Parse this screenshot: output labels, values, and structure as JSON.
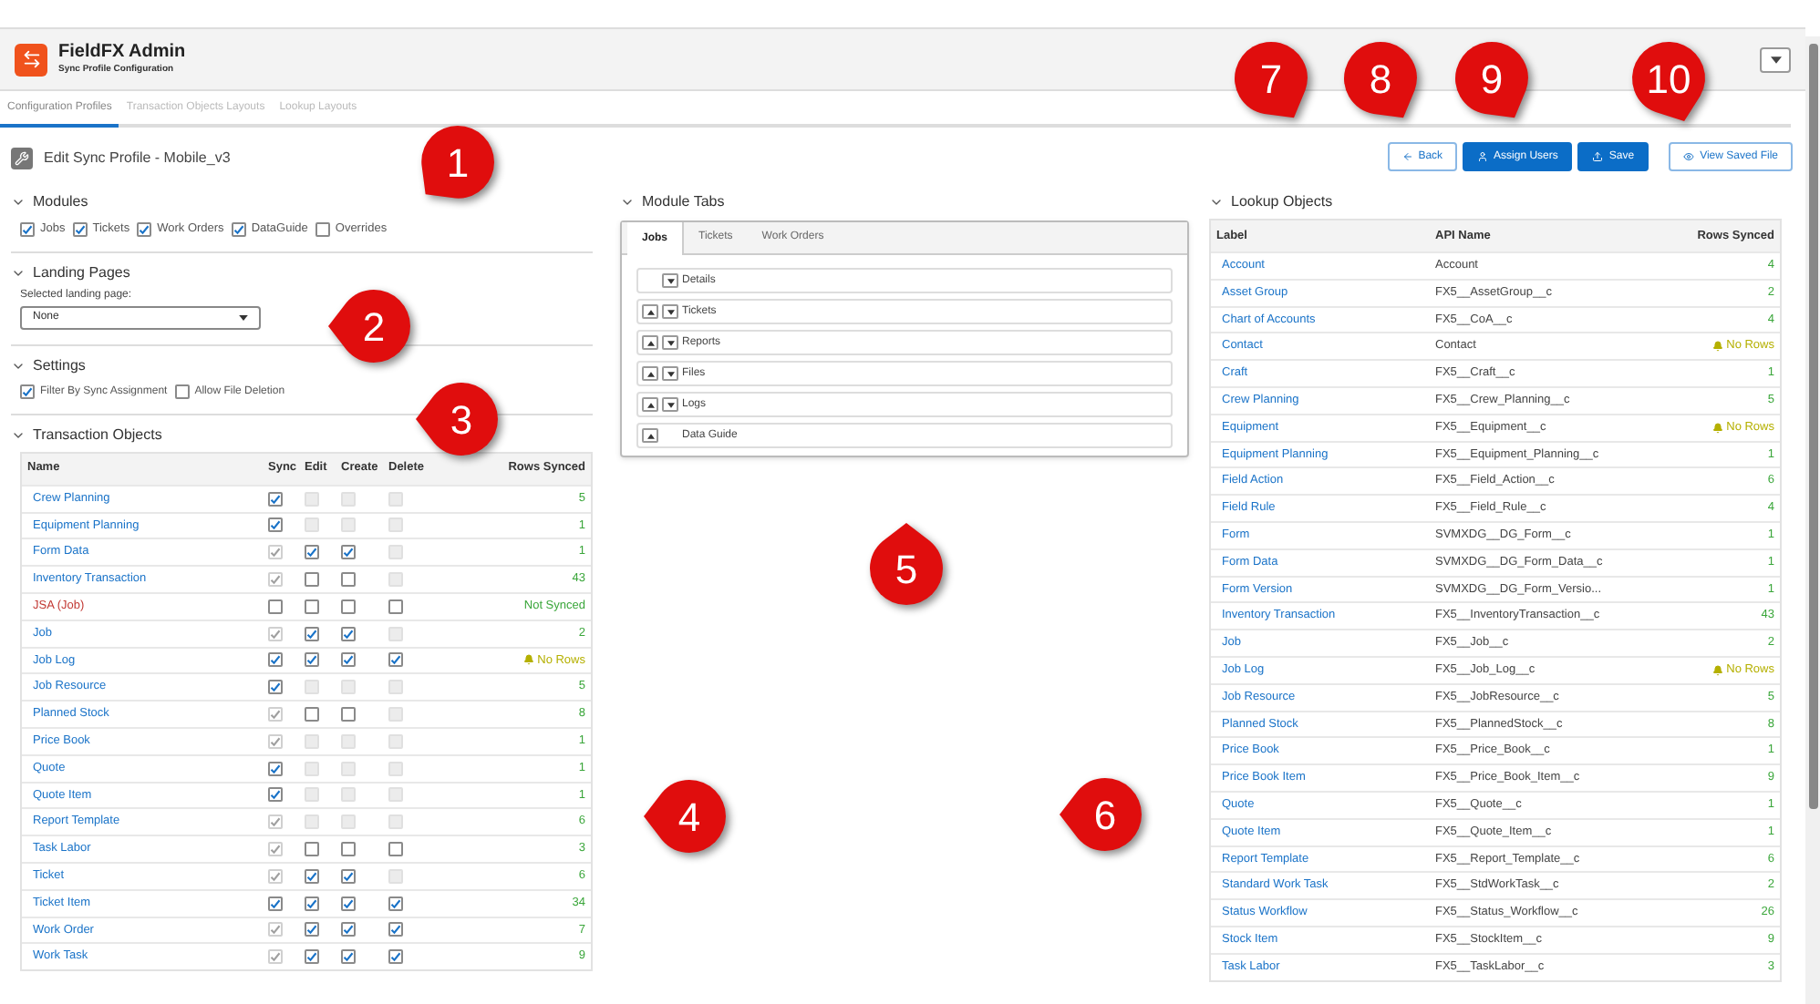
{
  "app": {
    "title": "FieldFX Admin",
    "subtitle": "Sync Profile Configuration"
  },
  "tabs": [
    {
      "label": "Configuration Profiles",
      "selected": true
    },
    {
      "label": "Transaction Objects Layouts",
      "selected": false
    },
    {
      "label": "Lookup Layouts",
      "selected": false
    }
  ],
  "page_title": "Edit Sync Profile - Mobile_v3",
  "actions": [
    {
      "label": "Back",
      "kind": "outline"
    },
    {
      "label": "Assign Users",
      "kind": "primary"
    },
    {
      "label": "Save",
      "kind": "primary"
    },
    {
      "label": "View Saved File",
      "kind": "outline"
    }
  ],
  "modules": {
    "title": "Modules",
    "expanded": true,
    "options": [
      {
        "label": "Jobs",
        "checked": true
      },
      {
        "label": "Tickets",
        "checked": true
      },
      {
        "label": "Work Orders",
        "checked": true
      },
      {
        "label": "DataGuide",
        "checked": true
      },
      {
        "label": "Overrides",
        "checked": false
      }
    ]
  },
  "landing_pages": {
    "title": "Landing Pages",
    "expanded": true,
    "label": "Selected landing page:",
    "value": "None"
  },
  "settings": {
    "title": "Settings",
    "expanded": true,
    "options": [
      {
        "label": "Filter By Sync Assignment",
        "checked": true
      },
      {
        "label": "Allow File Deletion",
        "checked": false
      }
    ]
  },
  "transaction_objects": {
    "title": "Transaction Objects",
    "expanded": true,
    "columns": [
      "Name",
      "Sync",
      "Edit",
      "Create",
      "Delete",
      "Rows Synced"
    ],
    "rows": [
      {
        "name": "Crew Planning",
        "kind": "count",
        "rows_synced": "5",
        "sync": {
          "checked": true,
          "disabled": false
        },
        "edit": {
          "checked": false,
          "disabled": true
        },
        "create": {
          "checked": false,
          "disabled": true
        },
        "delete": {
          "checked": false,
          "disabled": true
        }
      },
      {
        "name": "Equipment Planning",
        "kind": "count",
        "rows_synced": "1",
        "sync": {
          "checked": true,
          "disabled": false
        },
        "edit": {
          "checked": false,
          "disabled": true
        },
        "create": {
          "checked": false,
          "disabled": true
        },
        "delete": {
          "checked": false,
          "disabled": true
        }
      },
      {
        "name": "Form Data",
        "kind": "count",
        "rows_synced": "1",
        "sync": {
          "checked": true,
          "disabled": true
        },
        "edit": {
          "checked": true,
          "disabled": false
        },
        "create": {
          "checked": true,
          "disabled": false
        },
        "delete": {
          "checked": false,
          "disabled": true
        }
      },
      {
        "name": "Inventory Transaction",
        "kind": "count",
        "rows_synced": "43",
        "sync": {
          "checked": true,
          "disabled": true
        },
        "edit": {
          "checked": false,
          "disabled": false
        },
        "create": {
          "checked": false,
          "disabled": false
        },
        "delete": {
          "checked": false,
          "disabled": true
        }
      },
      {
        "name": "JSA (Job)",
        "kind": "not_synced",
        "rows_synced": "Not Synced",
        "sync": {
          "checked": false,
          "disabled": false
        },
        "edit": {
          "checked": false,
          "disabled": false
        },
        "create": {
          "checked": false,
          "disabled": false
        },
        "delete": {
          "checked": false,
          "disabled": false
        }
      },
      {
        "name": "Job",
        "kind": "count",
        "rows_synced": "2",
        "sync": {
          "checked": true,
          "disabled": true
        },
        "edit": {
          "checked": true,
          "disabled": false
        },
        "create": {
          "checked": true,
          "disabled": false
        },
        "delete": {
          "checked": false,
          "disabled": true
        }
      },
      {
        "name": "Job Log",
        "kind": "no_rows",
        "rows_synced": "No Rows",
        "sync": {
          "checked": true,
          "disabled": false
        },
        "edit": {
          "checked": true,
          "disabled": false
        },
        "create": {
          "checked": true,
          "disabled": false
        },
        "delete": {
          "checked": true,
          "disabled": false
        }
      },
      {
        "name": "Job Resource",
        "kind": "count",
        "rows_synced": "5",
        "sync": {
          "checked": true,
          "disabled": false
        },
        "edit": {
          "checked": false,
          "disabled": true
        },
        "create": {
          "checked": false,
          "disabled": true
        },
        "delete": {
          "checked": false,
          "disabled": true
        }
      },
      {
        "name": "Planned Stock",
        "kind": "count",
        "rows_synced": "8",
        "sync": {
          "checked": true,
          "disabled": true
        },
        "edit": {
          "checked": false,
          "disabled": false
        },
        "create": {
          "checked": false,
          "disabled": false
        },
        "delete": {
          "checked": false,
          "disabled": true
        }
      },
      {
        "name": "Price Book",
        "kind": "count",
        "rows_synced": "1",
        "sync": {
          "checked": true,
          "disabled": true
        },
        "edit": {
          "checked": false,
          "disabled": true
        },
        "create": {
          "checked": false,
          "disabled": true
        },
        "delete": {
          "checked": false,
          "disabled": true
        }
      },
      {
        "name": "Quote",
        "kind": "count",
        "rows_synced": "1",
        "sync": {
          "checked": true,
          "disabled": false
        },
        "edit": {
          "checked": false,
          "disabled": true
        },
        "create": {
          "checked": false,
          "disabled": true
        },
        "delete": {
          "checked": false,
          "disabled": true
        }
      },
      {
        "name": "Quote Item",
        "kind": "count",
        "rows_synced": "1",
        "sync": {
          "checked": true,
          "disabled": false
        },
        "edit": {
          "checked": false,
          "disabled": true
        },
        "create": {
          "checked": false,
          "disabled": true
        },
        "delete": {
          "checked": false,
          "disabled": true
        }
      },
      {
        "name": "Report Template",
        "kind": "count",
        "rows_synced": "6",
        "sync": {
          "checked": true,
          "disabled": true
        },
        "edit": {
          "checked": false,
          "disabled": true
        },
        "create": {
          "checked": false,
          "disabled": true
        },
        "delete": {
          "checked": false,
          "disabled": true
        }
      },
      {
        "name": "Task Labor",
        "kind": "count",
        "rows_synced": "3",
        "sync": {
          "checked": true,
          "disabled": true
        },
        "edit": {
          "checked": false,
          "disabled": false
        },
        "create": {
          "checked": false,
          "disabled": false
        },
        "delete": {
          "checked": false,
          "disabled": false
        }
      },
      {
        "name": "Ticket",
        "kind": "count",
        "rows_synced": "6",
        "sync": {
          "checked": true,
          "disabled": true
        },
        "edit": {
          "checked": true,
          "disabled": false
        },
        "create": {
          "checked": true,
          "disabled": false
        },
        "delete": {
          "checked": false,
          "disabled": true
        }
      },
      {
        "name": "Ticket Item",
        "kind": "count",
        "rows_synced": "34",
        "sync": {
          "checked": true,
          "disabled": false
        },
        "edit": {
          "checked": true,
          "disabled": false
        },
        "create": {
          "checked": true,
          "disabled": false
        },
        "delete": {
          "checked": true,
          "disabled": false
        }
      },
      {
        "name": "Work Order",
        "kind": "count",
        "rows_synced": "7",
        "sync": {
          "checked": true,
          "disabled": true
        },
        "edit": {
          "checked": true,
          "disabled": false
        },
        "create": {
          "checked": true,
          "disabled": false
        },
        "delete": {
          "checked": true,
          "disabled": false
        }
      },
      {
        "name": "Work Task",
        "kind": "count",
        "rows_synced": "9",
        "sync": {
          "checked": true,
          "disabled": true
        },
        "edit": {
          "checked": true,
          "disabled": false
        },
        "create": {
          "checked": true,
          "disabled": false
        },
        "delete": {
          "checked": true,
          "disabled": false
        }
      }
    ]
  },
  "module_tabs": {
    "title": "Module Tabs",
    "expanded": true,
    "tabs": [
      {
        "label": "Jobs",
        "selected": true
      },
      {
        "label": "Tickets",
        "selected": false
      },
      {
        "label": "Work Orders",
        "selected": false
      }
    ],
    "items": [
      {
        "label": "Details",
        "up": false,
        "down": true
      },
      {
        "label": "Tickets",
        "up": true,
        "down": true
      },
      {
        "label": "Reports",
        "up": true,
        "down": true
      },
      {
        "label": "Files",
        "up": true,
        "down": true
      },
      {
        "label": "Logs",
        "up": true,
        "down": true
      },
      {
        "label": "Data Guide",
        "up": true,
        "down": false
      }
    ]
  },
  "lookup_objects": {
    "title": "Lookup Objects",
    "expanded": true,
    "columns": [
      "Label",
      "API Name",
      "Rows Synced"
    ],
    "rows": [
      {
        "label": "Account",
        "api_name": "Account",
        "kind": "count",
        "rows_synced": "4"
      },
      {
        "label": "Asset Group",
        "api_name": "FX5__AssetGroup__c",
        "kind": "count",
        "rows_synced": "2"
      },
      {
        "label": "Chart of Accounts",
        "api_name": "FX5__CoA__c",
        "kind": "count",
        "rows_synced": "4"
      },
      {
        "label": "Contact",
        "api_name": "Contact",
        "kind": "no_rows",
        "rows_synced": "No Rows"
      },
      {
        "label": "Craft",
        "api_name": "FX5__Craft__c",
        "kind": "count",
        "rows_synced": "1"
      },
      {
        "label": "Crew Planning",
        "api_name": "FX5__Crew_Planning__c",
        "kind": "count",
        "rows_synced": "5"
      },
      {
        "label": "Equipment",
        "api_name": "FX5__Equipment__c",
        "kind": "no_rows",
        "rows_synced": "No Rows"
      },
      {
        "label": "Equipment Planning",
        "api_name": "FX5__Equipment_Planning__c",
        "kind": "count",
        "rows_synced": "1"
      },
      {
        "label": "Field Action",
        "api_name": "FX5__Field_Action__c",
        "kind": "count",
        "rows_synced": "6"
      },
      {
        "label": "Field Rule",
        "api_name": "FX5__Field_Rule__c",
        "kind": "count",
        "rows_synced": "4"
      },
      {
        "label": "Form",
        "api_name": "SVMXDG__DG_Form__c",
        "kind": "count",
        "rows_synced": "1"
      },
      {
        "label": "Form Data",
        "api_name": "SVMXDG__DG_Form_Data__c",
        "kind": "count",
        "rows_synced": "1"
      },
      {
        "label": "Form Version",
        "api_name": "SVMXDG__DG_Form_Versio...",
        "kind": "count",
        "rows_synced": "1"
      },
      {
        "label": "Inventory Transaction",
        "api_name": "FX5__InventoryTransaction__c",
        "kind": "count",
        "rows_synced": "43"
      },
      {
        "label": "Job",
        "api_name": "FX5__Job__c",
        "kind": "count",
        "rows_synced": "2"
      },
      {
        "label": "Job Log",
        "api_name": "FX5__Job_Log__c",
        "kind": "no_rows",
        "rows_synced": "No Rows"
      },
      {
        "label": "Job Resource",
        "api_name": "FX5__JobResource__c",
        "kind": "count",
        "rows_synced": "5"
      },
      {
        "label": "Planned Stock",
        "api_name": "FX5__PlannedStock__c",
        "kind": "count",
        "rows_synced": "8"
      },
      {
        "label": "Price Book",
        "api_name": "FX5__Price_Book__c",
        "kind": "count",
        "rows_synced": "1"
      },
      {
        "label": "Price Book Item",
        "api_name": "FX5__Price_Book_Item__c",
        "kind": "count",
        "rows_synced": "9"
      },
      {
        "label": "Quote",
        "api_name": "FX5__Quote__c",
        "kind": "count",
        "rows_synced": "1"
      },
      {
        "label": "Quote Item",
        "api_name": "FX5__Quote_Item__c",
        "kind": "count",
        "rows_synced": "1"
      },
      {
        "label": "Report Template",
        "api_name": "FX5__Report_Template__c",
        "kind": "count",
        "rows_synced": "6"
      },
      {
        "label": "Standard Work Task",
        "api_name": "FX5__StdWorkTask__c",
        "kind": "count",
        "rows_synced": "2"
      },
      {
        "label": "Status Workflow",
        "api_name": "FX5__Status_Workflow__c",
        "kind": "count",
        "rows_synced": "26"
      },
      {
        "label": "Stock Item",
        "api_name": "FX5__StockItem__c",
        "kind": "count",
        "rows_synced": "9"
      },
      {
        "label": "Task Labor",
        "api_name": "FX5__TaskLabor__c",
        "kind": "count",
        "rows_synced": "3"
      }
    ]
  },
  "callouts": [
    "1",
    "2",
    "3",
    "4",
    "5",
    "6",
    "7",
    "8",
    "9",
    "10"
  ]
}
